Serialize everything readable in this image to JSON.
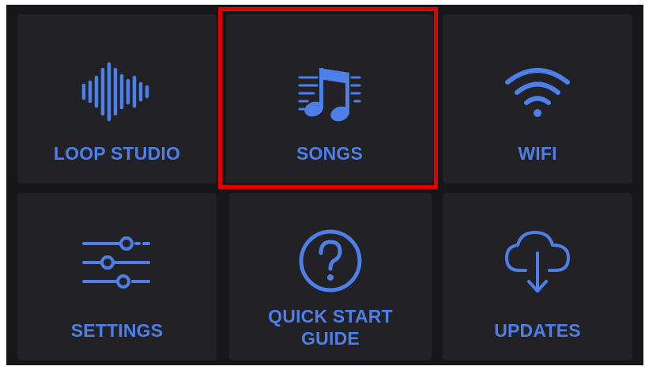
{
  "menu": {
    "tiles": [
      {
        "label": "LOOP STUDIO",
        "icon": "waveform-icon"
      },
      {
        "label": "SONGS",
        "icon": "music-notes-icon",
        "selected": true
      },
      {
        "label": "WIFI",
        "icon": "wifi-icon"
      },
      {
        "label": "SETTINGS",
        "icon": "sliders-icon"
      },
      {
        "label": "QUICK START\nGUIDE",
        "icon": "help-circle-icon"
      },
      {
        "label": "UPDATES",
        "icon": "cloud-download-icon"
      }
    ]
  },
  "colors": {
    "accent": "#4d7fe6",
    "tile_background": "#222226",
    "panel_background": "#17171a",
    "selection_border": "#e10000"
  }
}
